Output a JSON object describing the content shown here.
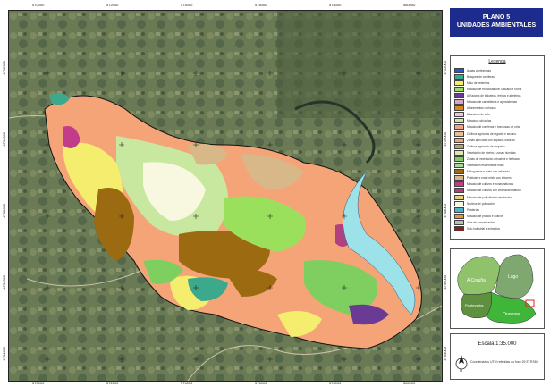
{
  "title": {
    "line1": "PLANO 5",
    "line2": "UNIDADES AMBIENTALES"
  },
  "legend": {
    "title": "Lexenda",
    "items": [
      {
        "label": "Augas continentais",
        "color": "#2a58c8"
      },
      {
        "label": "Bosques de coníferas",
        "color": "#3ca88c"
      },
      {
        "label": "Mato de xesteiras",
        "color": "#f5ed6e"
      },
      {
        "label": "Mosaico de frondosas con cascallo e rocha",
        "color": "#9be05c"
      },
      {
        "label": "Aliñacións de bidueiros, freixos e abeleiras",
        "color": "#6b3a95"
      },
      {
        "label": "Mosaico de carballeiras e agrosistemas",
        "color": "#d5a8c8"
      },
      {
        "label": "Afloramentos rochosos",
        "color": "#d48a20"
      },
      {
        "label": "Abandono de solo",
        "color": "#f0c4dc"
      },
      {
        "label": "Mosaicos silvícolas",
        "color": "#c8e8a0"
      },
      {
        "label": "Mosaico de coníferas e frondosas de orixe",
        "color": "#f4a08c"
      },
      {
        "label": "Cultivos agrícolas de regadío e secano",
        "color": "#e8c090"
      },
      {
        "label": "Zonas agrícolas con espazos naturais",
        "color": "#f5a478"
      },
      {
        "label": "Cultivos agrícolas de sequeiro",
        "color": "#b8a070"
      },
      {
        "label": "Vexetación de ribeira e zonas húmidas",
        "color": "#e0e8b0"
      },
      {
        "label": "Zonas de vexetación arbustiva e herbácea",
        "color": "#7ecf60"
      },
      {
        "label": "Vexetación esclerófila e mato",
        "color": "#a8d898"
      },
      {
        "label": "Matogueiras e mato con arborado",
        "color": "#9c6a10"
      },
      {
        "label": "Pastizais e mato mixto con árbores",
        "color": "#d8b888"
      },
      {
        "label": "Mosaico de cultivos e zonas naturais",
        "color": "#c23c8c"
      },
      {
        "label": "Mosaico de cultivos con vexetación natural",
        "color": "#b04080"
      },
      {
        "label": "Mosaico de policultivo e vexetación",
        "color": "#e8d080"
      },
      {
        "label": "Núcleos de poboación",
        "color": "#f8f8e0"
      },
      {
        "label": "Praderías",
        "color": "#4cb4c8"
      },
      {
        "label": "Mosaico de prados e cultivos",
        "color": "#e89838"
      },
      {
        "label": "Vías de comunicación",
        "color": "#bcbcbc"
      },
      {
        "label": "Solo industrial e extractivo",
        "color": "#7a2424"
      }
    ]
  },
  "locator": {
    "regions": [
      {
        "name": "A Coruña",
        "color": "#8fc26a"
      },
      {
        "name": "Lugo",
        "color": "#7fa870"
      },
      {
        "name": "Pontevedra",
        "color": "#5f9040"
      },
      {
        "name": "Ourense",
        "color": "#3fb63a"
      }
    ]
  },
  "scale": {
    "label": "Escala 1:35.000"
  },
  "coords": {
    "text": "Coordenadas UTM referidas ao fuso 29 ETRS89"
  },
  "axis": {
    "top_ticks": [
      "570000",
      "572000",
      "574000",
      "576000",
      "578000",
      "580000"
    ],
    "left_ticks": [
      "4712000",
      "4710000",
      "4708000",
      "4706000",
      "4704000"
    ]
  },
  "colors": {
    "background_satellite": "#5a6b4a",
    "river": "#9ce2e8",
    "title_bg": "#1c2b8c"
  }
}
